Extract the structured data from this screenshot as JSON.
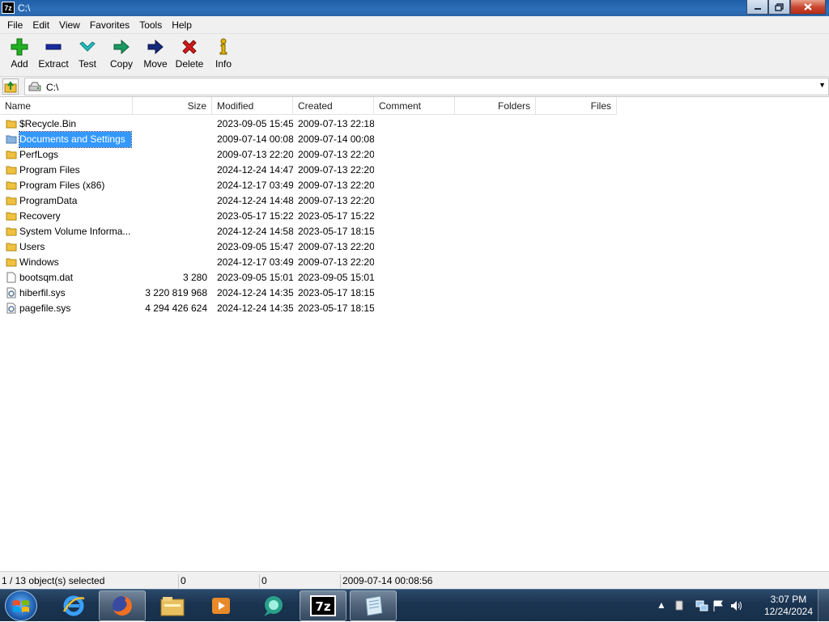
{
  "window": {
    "title": "C:\\",
    "icon_text": "7z",
    "buttons": [
      "minimize-icon",
      "restore-icon",
      "close-icon"
    ]
  },
  "menu": [
    "File",
    "Edit",
    "View",
    "Favorites",
    "Tools",
    "Help"
  ],
  "toolbar": [
    {
      "label": "Add",
      "icon": "plus-icon",
      "color": "#1faa1f"
    },
    {
      "label": "Extract",
      "icon": "minus-icon",
      "color": "#1a2a9a"
    },
    {
      "label": "Test",
      "icon": "check-icon",
      "color": "#1fb0b0"
    },
    {
      "label": "Copy",
      "icon": "copy-arrow-icon",
      "color": "#1a8a5a"
    },
    {
      "label": "Move",
      "icon": "move-arrow-icon",
      "color": "#142a7a"
    },
    {
      "label": "Delete",
      "icon": "delete-x-icon",
      "color": "#d11a1a"
    },
    {
      "label": "Info",
      "icon": "info-icon",
      "color": "#c9a000"
    }
  ],
  "address": {
    "path": "C:\\"
  },
  "columns": [
    "Name",
    "Size",
    "Modified",
    "Created",
    "Comment",
    "Folders",
    "Files"
  ],
  "rows": [
    {
      "type": "folder",
      "name": "$Recycle.Bin",
      "size": "",
      "modified": "2023-09-05 15:45",
      "created": "2009-07-13 22:18"
    },
    {
      "type": "folder-link",
      "name": "Documents and Settings",
      "size": "",
      "modified": "2009-07-14 00:08",
      "created": "2009-07-14 00:08",
      "selected": true
    },
    {
      "type": "folder",
      "name": "PerfLogs",
      "size": "",
      "modified": "2009-07-13 22:20",
      "created": "2009-07-13 22:20"
    },
    {
      "type": "folder",
      "name": "Program Files",
      "size": "",
      "modified": "2024-12-24 14:47",
      "created": "2009-07-13 22:20"
    },
    {
      "type": "folder",
      "name": "Program Files (x86)",
      "size": "",
      "modified": "2024-12-17 03:49",
      "created": "2009-07-13 22:20"
    },
    {
      "type": "folder",
      "name": "ProgramData",
      "size": "",
      "modified": "2024-12-24 14:48",
      "created": "2009-07-13 22:20"
    },
    {
      "type": "folder",
      "name": "Recovery",
      "size": "",
      "modified": "2023-05-17 15:22",
      "created": "2023-05-17 15:22"
    },
    {
      "type": "folder",
      "name": "System Volume Informa...",
      "size": "",
      "modified": "2024-12-24 14:58",
      "created": "2023-05-17 18:15"
    },
    {
      "type": "folder",
      "name": "Users",
      "size": "",
      "modified": "2023-09-05 15:47",
      "created": "2009-07-13 22:20"
    },
    {
      "type": "folder",
      "name": "Windows",
      "size": "",
      "modified": "2024-12-17 03:49",
      "created": "2009-07-13 22:20"
    },
    {
      "type": "file",
      "name": "bootsqm.dat",
      "size": "3 280",
      "modified": "2023-09-05 15:01",
      "created": "2023-09-05 15:01"
    },
    {
      "type": "sysfile",
      "name": "hiberfil.sys",
      "size": "3 220 819 968",
      "modified": "2024-12-24 14:35",
      "created": "2023-05-17 18:15"
    },
    {
      "type": "sysfile",
      "name": "pagefile.sys",
      "size": "4 294 426 624",
      "modified": "2024-12-24 14:35",
      "created": "2023-05-17 18:15"
    }
  ],
  "status": {
    "selection": "1 / 13 object(s) selected",
    "size": "0",
    "packed": "0",
    "modified": "2009-07-14 00:08:56"
  },
  "taskbar": {
    "apps": [
      "internet-explorer-icon",
      "firefox-icon",
      "file-explorer-icon",
      "media-player-icon",
      "chat-app-icon",
      "7zip-icon",
      "notepad-icon"
    ],
    "time": "3:07 PM",
    "date": "12/24/2024"
  }
}
